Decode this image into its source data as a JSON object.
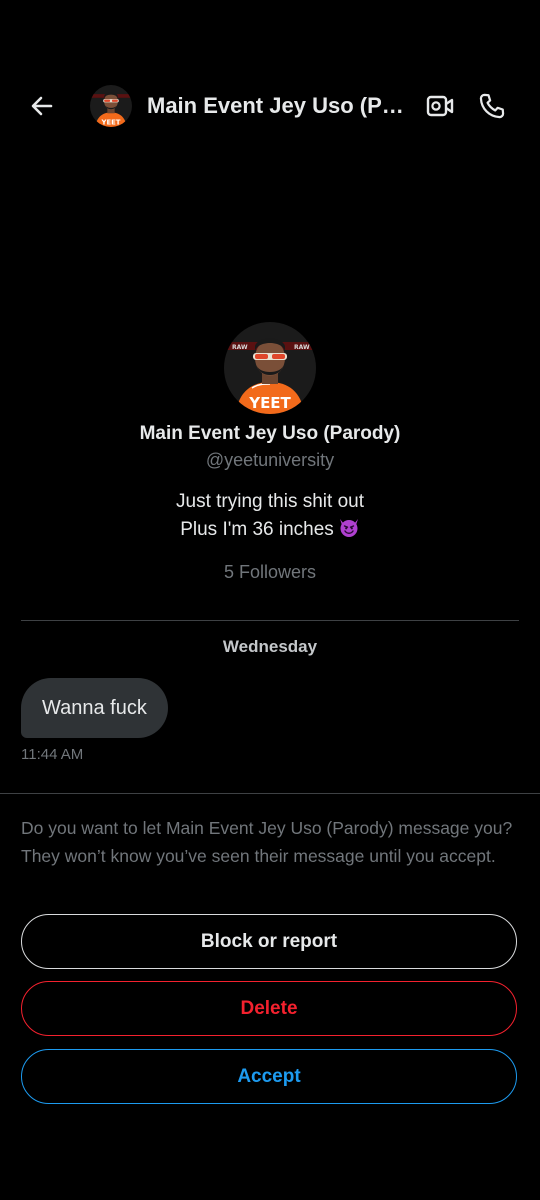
{
  "header": {
    "title": "Main Event Jey Uso (Parody)",
    "back_icon": "arrow-left-icon",
    "video_icon": "video-call-icon",
    "call_icon": "phone-icon"
  },
  "profile": {
    "name": "Main Event Jey Uso (Parody)",
    "handle": "@yeetuniversity",
    "bio_line1": "Just trying this shit out",
    "bio_line2": "Plus I'm 36 inches",
    "bio_emoji": "smiling-devil-emoji",
    "followers": "5 Followers",
    "avatar_shirt_text": "YEET"
  },
  "conversation": {
    "day_label": "Wednesday",
    "messages": [
      {
        "text": "Wanna fuck",
        "time": "11:44 AM"
      }
    ]
  },
  "request": {
    "prompt": "Do you want to let Main Event Jey Uso (Parody) message you? They won’t know you’ve seen their message until you accept.",
    "block_label": "Block or report",
    "delete_label": "Delete",
    "accept_label": "Accept"
  },
  "colors": {
    "background": "#000000",
    "text_primary": "#e7e9ea",
    "text_secondary": "#71767b",
    "bubble": "#2f3336",
    "danger": "#f4212e",
    "accent": "#1d9bf0"
  }
}
